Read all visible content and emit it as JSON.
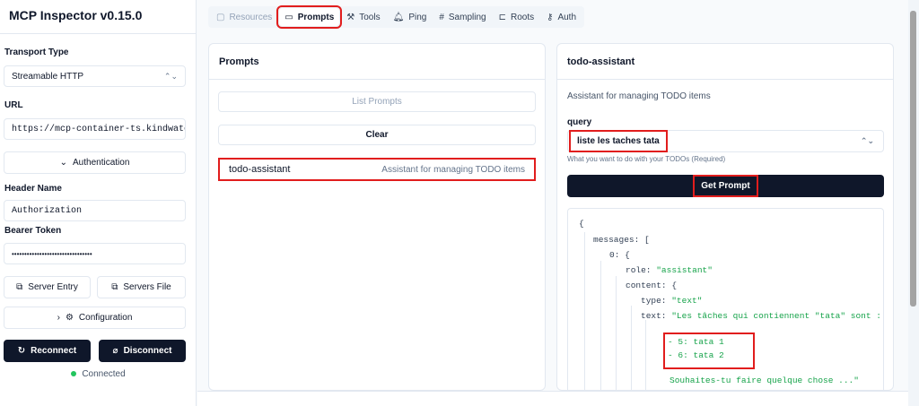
{
  "app": {
    "title": "MCP Inspector v0.15.0"
  },
  "sidebar": {
    "transport_label": "Transport Type",
    "transport_value": "Streamable HTTP",
    "url_label": "URL",
    "url_value": "https://mcp-container-ts.kindwater",
    "auth_button": "Authentication",
    "header_name_label": "Header Name",
    "header_name_value": "Authorization",
    "bearer_label": "Bearer Token",
    "bearer_value": "••••••••••••••••••••••••••••••••",
    "server_entry_button": "Server Entry",
    "servers_file_button": "Servers File",
    "configuration_button": "Configuration",
    "reconnect_button": "Reconnect",
    "disconnect_button": "Disconnect",
    "status": "Connected"
  },
  "tabs": [
    {
      "label": "Resources",
      "icon": "resources-icon"
    },
    {
      "label": "Prompts",
      "icon": "prompts-icon"
    },
    {
      "label": "Tools",
      "icon": "tools-icon"
    },
    {
      "label": "Ping",
      "icon": "bell-icon"
    },
    {
      "label": "Sampling",
      "icon": "hash-icon"
    },
    {
      "label": "Roots",
      "icon": "roots-icon"
    },
    {
      "label": "Auth",
      "icon": "key-icon"
    }
  ],
  "prompts_panel": {
    "title": "Prompts",
    "list_button": "List Prompts",
    "clear_button": "Clear",
    "items": [
      {
        "name": "todo-assistant",
        "description": "Assistant for managing TODO items"
      }
    ]
  },
  "detail_panel": {
    "title": "todo-assistant",
    "description": "Assistant for managing TODO items",
    "query_label": "query",
    "query_value": "liste les taches tata",
    "query_help": "What you want to do with your TODOs (Required)",
    "get_button": "Get Prompt",
    "json": {
      "open_brace": "{",
      "messages_key": "messages:",
      "bracket": "[",
      "index_key": "0:",
      "brace": "{",
      "role_key": "role:",
      "role_value": "\"assistant\"",
      "content_key": "content:",
      "type_key": "type:",
      "type_value": "\"text\"",
      "text_key": "text:",
      "text_line1": "\"Les tâches qui contiennent \"tata\" sont :",
      "text_line2": "- 5: tata 1",
      "text_line3": "- 6: tata 2",
      "text_line4": "Souhaites-tu faire quelque chose ...\""
    }
  }
}
